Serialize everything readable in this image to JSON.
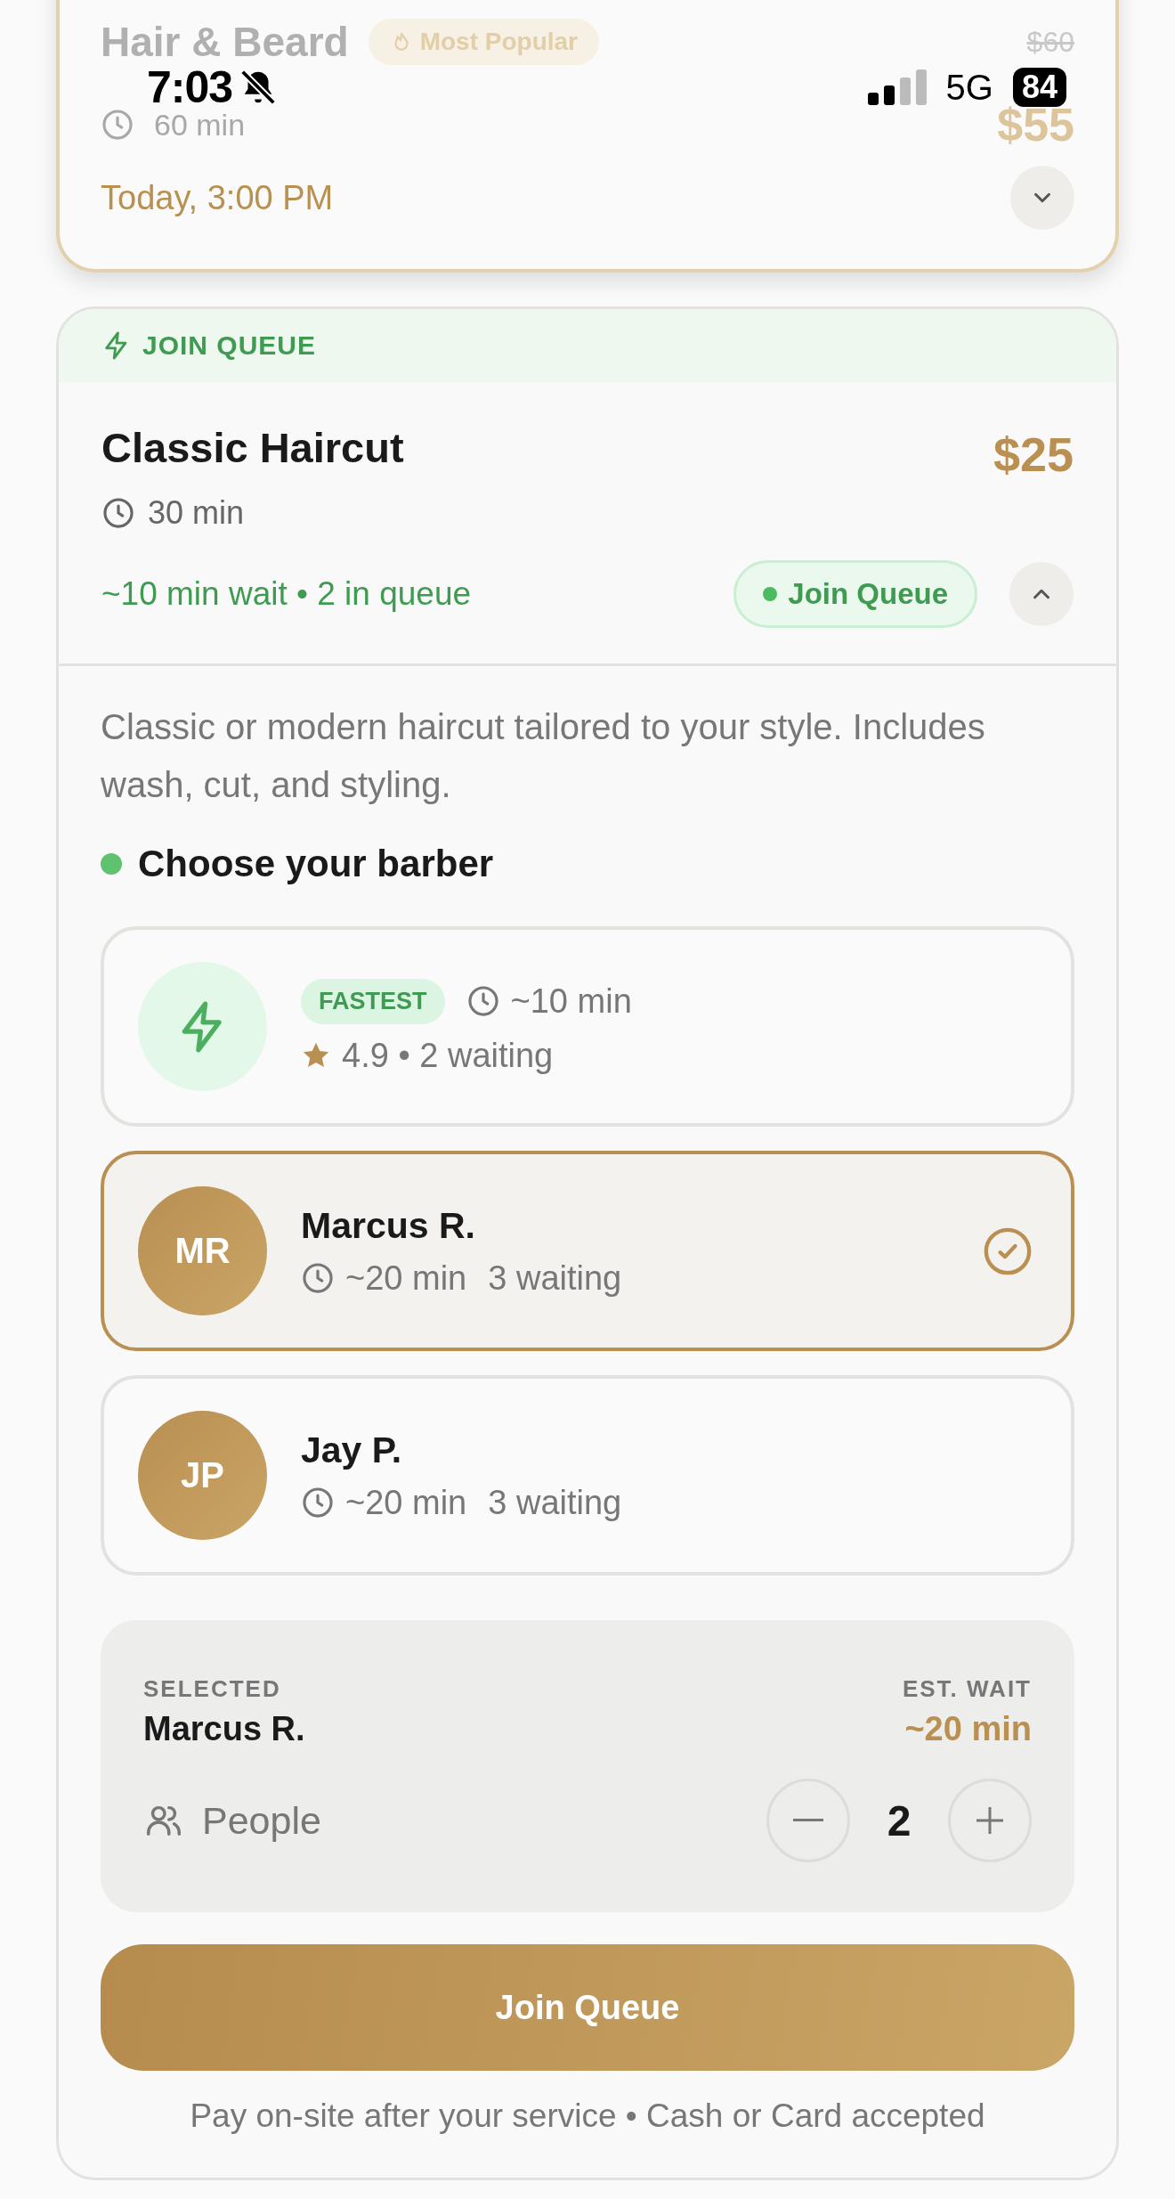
{
  "status_bar": {
    "time": "7:03",
    "network": "5G",
    "battery": "84"
  },
  "booked_service": {
    "name": "Hair & Beard",
    "badge": "Most Popular",
    "duration": "60 min",
    "original_price": "$60",
    "price": "$55",
    "appointment": "Today, 3:00 PM",
    "expanded": false
  },
  "queue_service": {
    "header": "JOIN QUEUE",
    "name": "Classic Haircut",
    "price": "$25",
    "duration": "30 min",
    "wait_info": "~10 min wait • 2 in queue",
    "join_badge": "Join Queue",
    "expanded": true,
    "description": "Classic or modern haircut tailored to your style. Includes wash, cut, and styling.",
    "barber_heading": "Choose your barber",
    "barbers": [
      {
        "kind": "fastest",
        "tag": "FASTEST",
        "wait": "~10 min",
        "rating": "4.9 • 2 waiting",
        "selected": false
      },
      {
        "kind": "barber",
        "initials": "MR",
        "name": "Marcus R.",
        "wait": "~20 min",
        "waiting": "3 waiting",
        "selected": true
      },
      {
        "kind": "barber",
        "initials": "JP",
        "name": "Jay P.",
        "wait": "~20 min",
        "waiting": "3 waiting",
        "selected": false
      }
    ]
  },
  "summary": {
    "selected_label": "SELECTED",
    "selected_name": "Marcus R.",
    "wait_label": "EST. WAIT",
    "wait_value": "~20 min",
    "people_label": "People",
    "people_count": "2"
  },
  "join_button": "Join Queue",
  "footer": "Pay on-site after your service • Cash or Card accepted"
}
